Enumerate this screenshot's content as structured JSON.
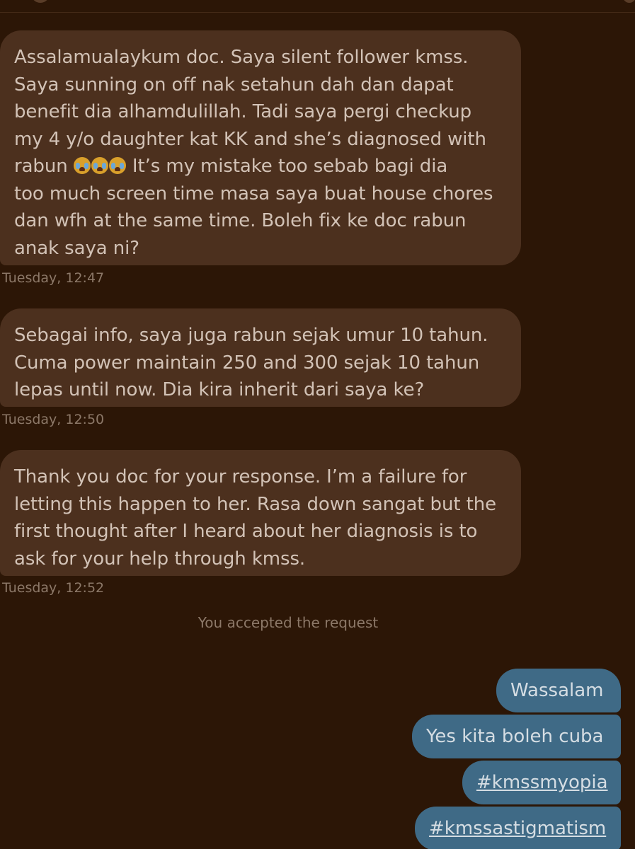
{
  "incoming_messages": [
    {
      "text_before_emoji": "Assalamualaykum doc. Saya silent follower kmss.\nSaya sunning on off nak setahun dah dan dapat\nbenefit dia alhamdulillah. Tadi saya pergi checkup\nmy 4 y/o daughter kat KK and she’s diagnosed with\nrabun ",
      "emojis": [
        "loudly-crying-face",
        "loudly-crying-face",
        "loudly-crying-face"
      ],
      "text_after_emoji": " It’s my mistake too sebab bagi dia\ntoo much screen time masa saya buat house chores\ndan wfh at the same time. Boleh fix ke doc rabun\nanak saya ni?",
      "timestamp": "Tuesday, 12:47"
    },
    {
      "text": "Sebagai info, saya juga rabun sejak umur 10 tahun.\nCuma power maintain 250 and 300 sejak 10 tahun\nlepas until now.  Dia kira inherit dari saya ke?",
      "timestamp": "Tuesday, 12:50"
    },
    {
      "text": "Thank you doc for your response. I’m a failure for\nletting this happen to her. Rasa down sangat but the\nfirst thought after I heard about her diagnosis is to\nask for your help through kmss.",
      "timestamp": "Tuesday, 12:52"
    }
  ],
  "system_note": "You accepted the request",
  "outgoing_messages": [
    {
      "text": "Wassalam"
    },
    {
      "text": "Yes kita boleh cuba"
    },
    {
      "text": "#kmssmyopia"
    },
    {
      "text": "#kmssastigmatism"
    }
  ],
  "colors": {
    "background": "#2c1606",
    "incoming_bubble": "#4c301e",
    "outgoing_bubble": "#3f6a86",
    "muted_text": "#8c7868"
  }
}
